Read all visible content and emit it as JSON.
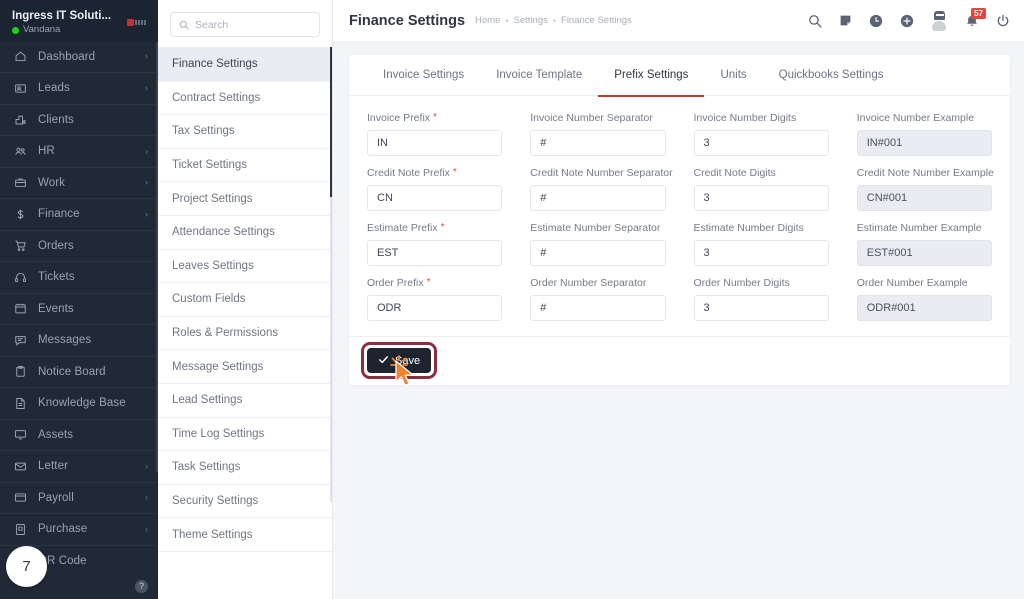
{
  "sidebar": {
    "company": "Ingress IT Soluti...",
    "username": "Vandana",
    "status_color": "#19d219",
    "badge_number": "7",
    "help_label": "?",
    "items": [
      {
        "label": "Dashboard",
        "icon": "home-icon",
        "chevron": "›"
      },
      {
        "label": "Leads",
        "icon": "lead-card-icon",
        "chevron": "›"
      },
      {
        "label": "Clients",
        "icon": "building-icon",
        "chevron": ""
      },
      {
        "label": "HR",
        "icon": "people-icon",
        "chevron": "›"
      },
      {
        "label": "Work",
        "icon": "briefcase-icon",
        "chevron": "›"
      },
      {
        "label": "Finance",
        "icon": "dollar-icon",
        "chevron": "›"
      },
      {
        "label": "Orders",
        "icon": "cart-icon",
        "chevron": ""
      },
      {
        "label": "Tickets",
        "icon": "headset-icon",
        "chevron": ""
      },
      {
        "label": "Events",
        "icon": "calendar-icon",
        "chevron": ""
      },
      {
        "label": "Messages",
        "icon": "chat-icon",
        "chevron": ""
      },
      {
        "label": "Notice Board",
        "icon": "clipboard-icon",
        "chevron": ""
      },
      {
        "label": "Knowledge Base",
        "icon": "document-icon",
        "chevron": ""
      },
      {
        "label": "Assets",
        "icon": "monitor-icon",
        "chevron": ""
      },
      {
        "label": "Letter",
        "icon": "envelope-icon",
        "chevron": "›"
      },
      {
        "label": "Payroll",
        "icon": "wallet-icon",
        "chevron": "›"
      },
      {
        "label": "Purchase",
        "icon": "purchase-icon",
        "chevron": "›"
      },
      {
        "label": "QR Code",
        "icon": "qr-code-icon",
        "chevron": ""
      }
    ]
  },
  "settings_panel": {
    "search_placeholder": "Search",
    "search_value": "",
    "search_icon": "search-icon",
    "items": [
      "Finance Settings",
      "Contract Settings",
      "Tax Settings",
      "Ticket Settings",
      "Project Settings",
      "Attendance Settings",
      "Leaves Settings",
      "Custom Fields",
      "Roles & Permissions",
      "Message Settings",
      "Lead Settings",
      "Time Log Settings",
      "Task Settings",
      "Security Settings",
      "Theme Settings"
    ],
    "active_index": 0
  },
  "topbar": {
    "title": "Finance Settings",
    "breadcrumb": [
      "Home",
      "Settings",
      "Finance Settings"
    ],
    "breadcrumb_separator": "•",
    "icons": [
      "search-icon",
      "note-icon",
      "clock-icon",
      "plus-circle-icon"
    ],
    "avatar": "user-avatar",
    "bell_icon": "bell-icon",
    "bell_badge": "57",
    "bell_badge_color": "#e8453c",
    "power_icon": "power-icon"
  },
  "tabs": [
    {
      "label": "Invoice Settings",
      "active": false
    },
    {
      "label": "Invoice Template",
      "active": false
    },
    {
      "label": "Prefix Settings",
      "active": true
    },
    {
      "label": "Units",
      "active": false
    },
    {
      "label": "Quickbooks Settings",
      "active": false
    }
  ],
  "tab_accent_color": "#c0392b",
  "form": {
    "rows": [
      {
        "prefix": {
          "label": "Invoice Prefix",
          "required": true,
          "value": "IN",
          "readonly": false
        },
        "separator": {
          "label": "Invoice Number Separator",
          "required": false,
          "value": "#",
          "readonly": false
        },
        "digits": {
          "label": "Invoice Number Digits",
          "required": false,
          "value": "3",
          "readonly": false
        },
        "example": {
          "label": "Invoice Number Example",
          "required": false,
          "value": "IN#001",
          "readonly": true
        }
      },
      {
        "prefix": {
          "label": "Credit Note Prefix",
          "required": true,
          "value": "CN",
          "readonly": false
        },
        "separator": {
          "label": "Credit Note Number Separator",
          "required": false,
          "value": "#",
          "readonly": false
        },
        "digits": {
          "label": "Credit Note Digits",
          "required": false,
          "value": "3",
          "readonly": false
        },
        "example": {
          "label": "Credit Note Number Example",
          "required": false,
          "value": "CN#001",
          "readonly": true
        }
      },
      {
        "prefix": {
          "label": "Estimate Prefix",
          "required": true,
          "value": "EST",
          "readonly": false
        },
        "separator": {
          "label": "Estimate Number Separator",
          "required": false,
          "value": "#",
          "readonly": false
        },
        "digits": {
          "label": "Estimate Number Digits",
          "required": false,
          "value": "3",
          "readonly": false
        },
        "example": {
          "label": "Estimate Number Example",
          "required": false,
          "value": "EST#001",
          "readonly": true
        }
      },
      {
        "prefix": {
          "label": "Order Prefix",
          "required": true,
          "value": "ODR",
          "readonly": false
        },
        "separator": {
          "label": "Order Number Separator",
          "required": false,
          "value": "#",
          "readonly": false
        },
        "digits": {
          "label": "Order Number Digits",
          "required": false,
          "value": "3",
          "readonly": false
        },
        "example": {
          "label": "Order Number Example",
          "required": false,
          "value": "ODR#001",
          "readonly": true
        }
      }
    ],
    "required_marker": "*"
  },
  "footer": {
    "save_label": "Save",
    "save_icon": "check-icon",
    "save_bg": "#1d2430",
    "highlight_ring_color": "#8e2d3f",
    "cursor_color": "#f0832b"
  }
}
